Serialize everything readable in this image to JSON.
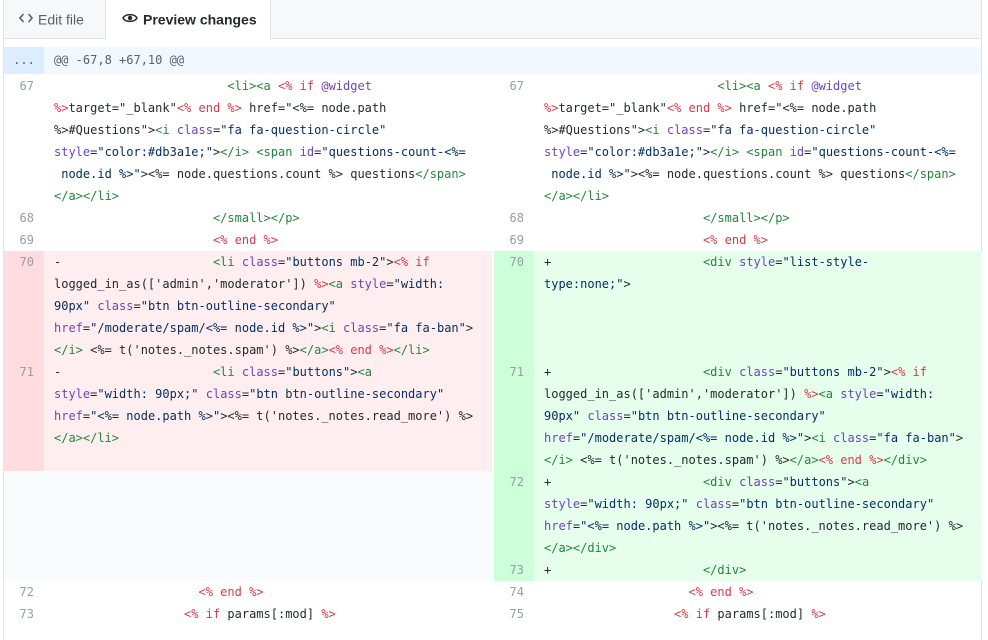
{
  "tabs": {
    "edit": {
      "label": "Edit file",
      "icon": "code-icon"
    },
    "preview": {
      "label": "Preview changes",
      "icon": "eye-icon"
    }
  },
  "hunk": {
    "expand": "...",
    "header": "@@ -67,8 +67,10 @@"
  },
  "left_numbers": [
    "67",
    "68",
    "69",
    "70",
    "71",
    "72",
    "73"
  ],
  "right_numbers": [
    "67",
    "68",
    "69",
    "70",
    "71",
    "72",
    "73",
    "74",
    "75"
  ],
  "colors": {
    "deleted_bg": "#ffeef0",
    "deleted_gutter": "#ffdce0",
    "added_bg": "#e6ffed",
    "added_gutter": "#cdffd8",
    "hunk_bg": "#f1f8ff"
  }
}
